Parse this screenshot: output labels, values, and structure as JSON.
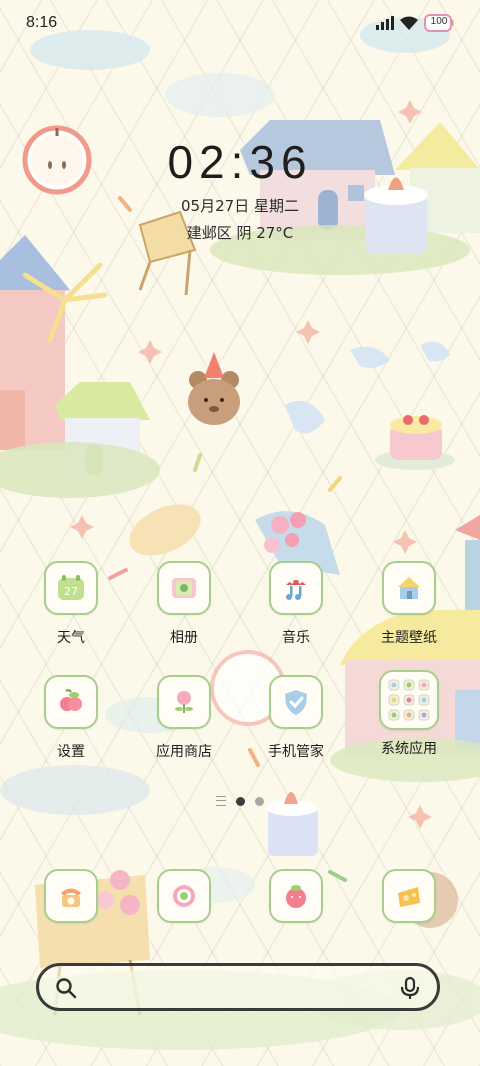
{
  "status_bar": {
    "time": "8:16",
    "battery": "100",
    "icons": [
      "signal-icon",
      "wifi-icon",
      "battery-icon"
    ]
  },
  "clock": {
    "time": "02:36",
    "date": "05月27日 星期二",
    "weather": "建邺区 阴 27°C"
  },
  "apps": [
    {
      "label": "天气",
      "icon": "weather-icon"
    },
    {
      "label": "相册",
      "icon": "gallery-icon"
    },
    {
      "label": "音乐",
      "icon": "music-icon"
    },
    {
      "label": "主题壁纸",
      "icon": "theme-wallpaper-icon"
    },
    {
      "label": "设置",
      "icon": "settings-icon"
    },
    {
      "label": "应用商店",
      "icon": "app-store-icon"
    },
    {
      "label": "手机管家",
      "icon": "phone-manager-icon"
    },
    {
      "label": "系统应用",
      "icon": "system-apps-folder-icon"
    }
  ],
  "weather_icon_number": "27",
  "pager": {
    "active_page": 2,
    "total_pages": 2
  },
  "dock": [
    {
      "icon": "phone-icon"
    },
    {
      "icon": "camera-icon"
    },
    {
      "icon": "messages-icon"
    },
    {
      "icon": "browser-icon"
    }
  ],
  "colors": {
    "background": "#fdf9ea",
    "icon_border": "#a7cf8c",
    "dot_active": "#3d3d3d",
    "dot_inactive": "#a8a8a8"
  }
}
